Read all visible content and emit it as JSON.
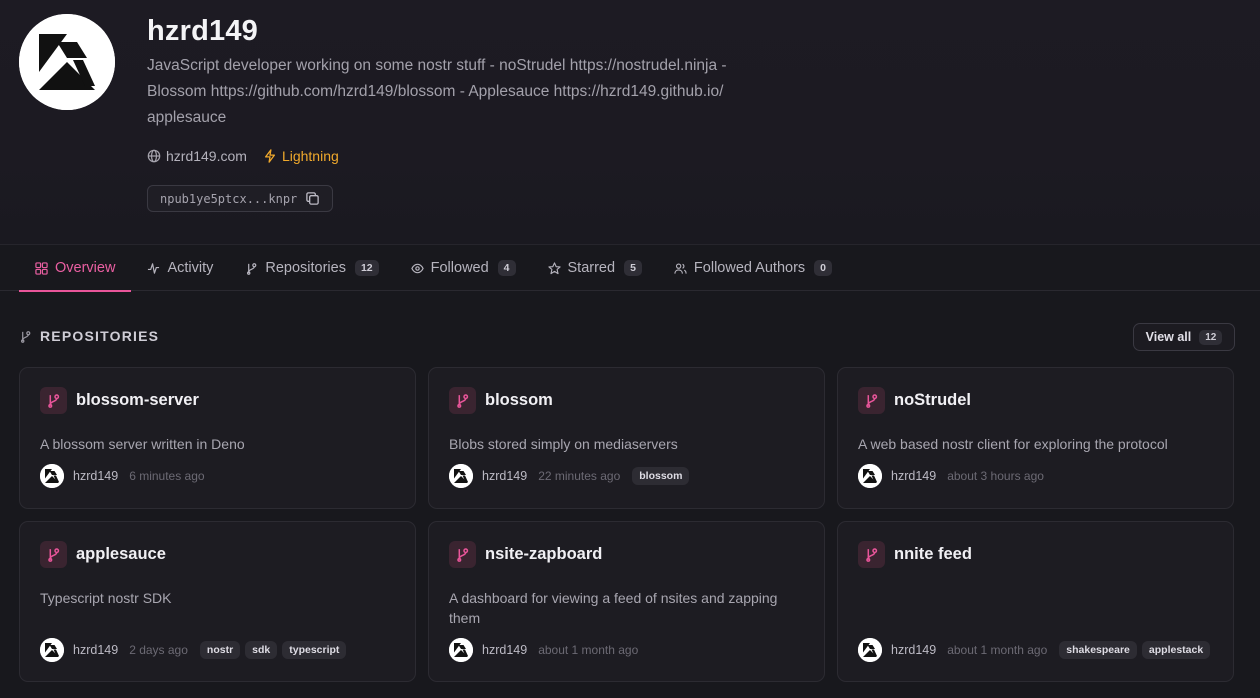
{
  "profile": {
    "name": "hzrd149",
    "bio": "JavaScript developer working on some nostr stuff - noStrudel https://nostrudel.ninja - Blossom https://github.com/hzrd149/blossom - Applesauce https://hzrd149.github.io/ applesauce",
    "website": "hzrd149.com",
    "lightning": "Lightning",
    "npub": "npub1ye5ptcx...knpr"
  },
  "tabs": [
    {
      "label": "Overview",
      "icon": "grid-icon",
      "count": null
    },
    {
      "label": "Activity",
      "icon": "activity-icon",
      "count": null
    },
    {
      "label": "Repositories",
      "icon": "git-branch-icon",
      "count": "12"
    },
    {
      "label": "Followed",
      "icon": "eye-icon",
      "count": "4"
    },
    {
      "label": "Starred",
      "icon": "star-icon",
      "count": "5"
    },
    {
      "label": "Followed Authors",
      "icon": "users-icon",
      "count": "0"
    }
  ],
  "section": {
    "title": "REPOSITORIES",
    "view_all": "View all",
    "view_all_count": "12"
  },
  "repos": [
    {
      "name": "blossom-server",
      "desc": "A blossom server written in Deno",
      "author": "hzrd149",
      "time": "6 minutes ago",
      "tags": []
    },
    {
      "name": "blossom",
      "desc": "Blobs stored simply on mediaservers",
      "author": "hzrd149",
      "time": "22 minutes ago",
      "tags": [
        "blossom"
      ]
    },
    {
      "name": "noStrudel",
      "desc": "A web based nostr client for exploring the protocol",
      "author": "hzrd149",
      "time": "about 3 hours ago",
      "tags": []
    },
    {
      "name": "applesauce",
      "desc": "Typescript nostr SDK",
      "author": "hzrd149",
      "time": "2 days ago",
      "tags": [
        "nostr",
        "sdk",
        "typescript"
      ]
    },
    {
      "name": "nsite-zapboard",
      "desc": "A dashboard for viewing a feed of nsites and zapping them",
      "author": "hzrd149",
      "time": "about 1 month ago",
      "tags": []
    },
    {
      "name": "nnite feed",
      "desc": "",
      "author": "hzrd149",
      "time": "about 1 month ago",
      "tags": [
        "shakespeare",
        "applestack"
      ]
    }
  ],
  "colors": {
    "accent": "#e9559a",
    "lightning": "#f0a92c",
    "background": "#18181d"
  }
}
